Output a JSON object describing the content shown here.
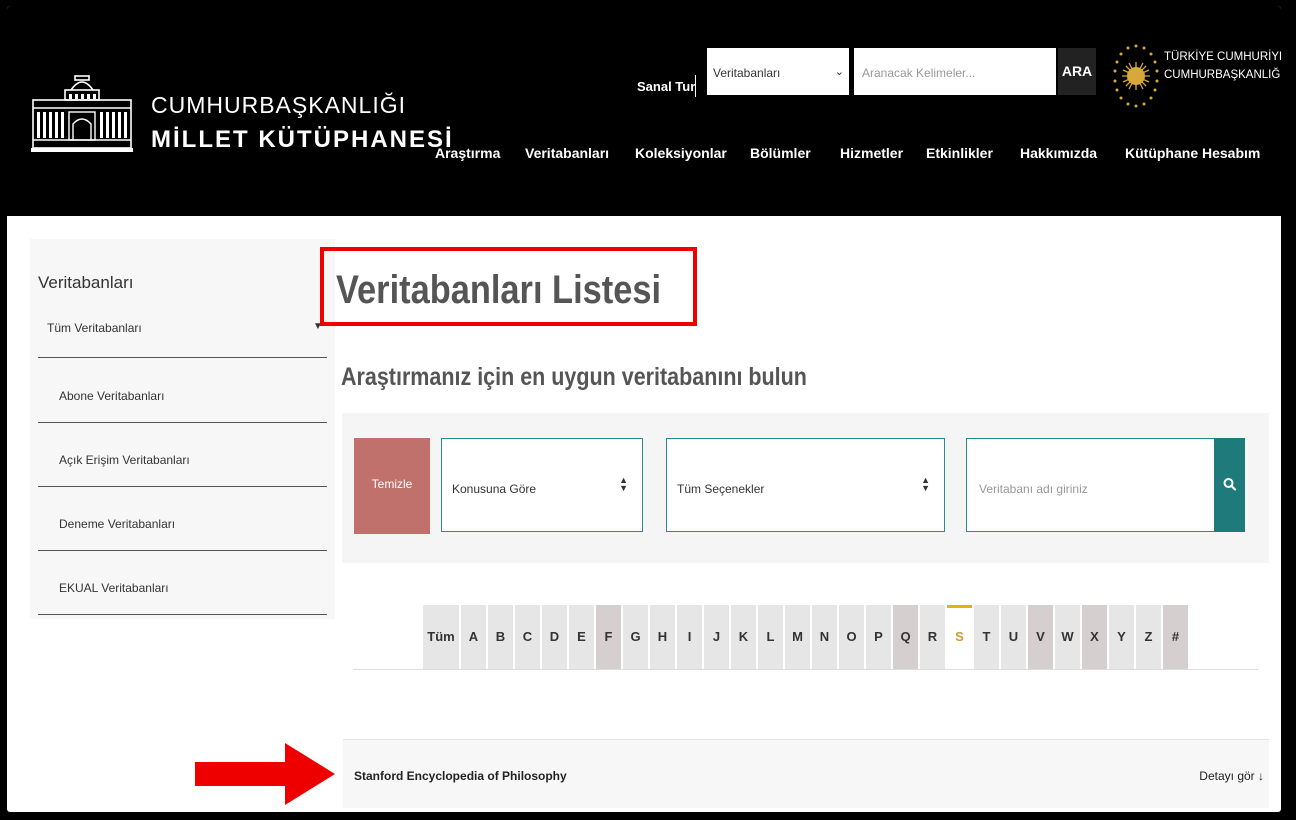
{
  "header": {
    "logo_line1": "CUMHURBAŞKANLIĞI",
    "logo_line2": "MİLLET KÜTÜPHANESİ",
    "virtual_tour": "Sanal Tur",
    "search_select_value": "Veritabanları",
    "search_placeholder": "Aranacak Kelimeler...",
    "search_button": "ARA",
    "gov_line1": "TÜRKİYE CUMHURİYETİ",
    "gov_line2": "CUMHURBAŞKANLIĞI",
    "nav": [
      "Araştırma",
      "Veritabanları",
      "Koleksiyonlar",
      "Bölümler",
      "Hizmetler",
      "Etkinlikler",
      "Hakkımızda",
      "Kütüphane Hesabım"
    ]
  },
  "sidebar": {
    "title": "Veritabanları",
    "selected": "Tüm Veritabanları",
    "items": [
      "Abone Veritabanları",
      "Açık Erişim Veritabanları",
      "Deneme Veritabanları",
      "EKUAL Veritabanları"
    ]
  },
  "main": {
    "title": "Veritabanları Listesi",
    "subtitle": "Araştırmanız için en uygun veritabanını bulun"
  },
  "filters": {
    "clear_button": "Temizle",
    "subject_select": "Konusuna Göre",
    "options_select": "Tüm Seçenekler",
    "name_placeholder": "Veritabanı adı giriniz"
  },
  "alphabet": {
    "letters": [
      "Tüm",
      "A",
      "B",
      "C",
      "D",
      "E",
      "F",
      "G",
      "H",
      "I",
      "J",
      "K",
      "L",
      "M",
      "N",
      "O",
      "P",
      "Q",
      "R",
      "S",
      "T",
      "U",
      "V",
      "W",
      "X",
      "Y",
      "Z",
      "#"
    ],
    "active": "S"
  },
  "results": [
    {
      "name": "Stanford Encyclopedia of Philosophy",
      "detail": "Detayı gör ↓"
    }
  ],
  "colors": {
    "header_bg": "#000000",
    "clear_button": "#c1716b",
    "teal": "#1f7b7b",
    "active_letter": "#d29a2c",
    "annotation_red": "#ee0000"
  }
}
